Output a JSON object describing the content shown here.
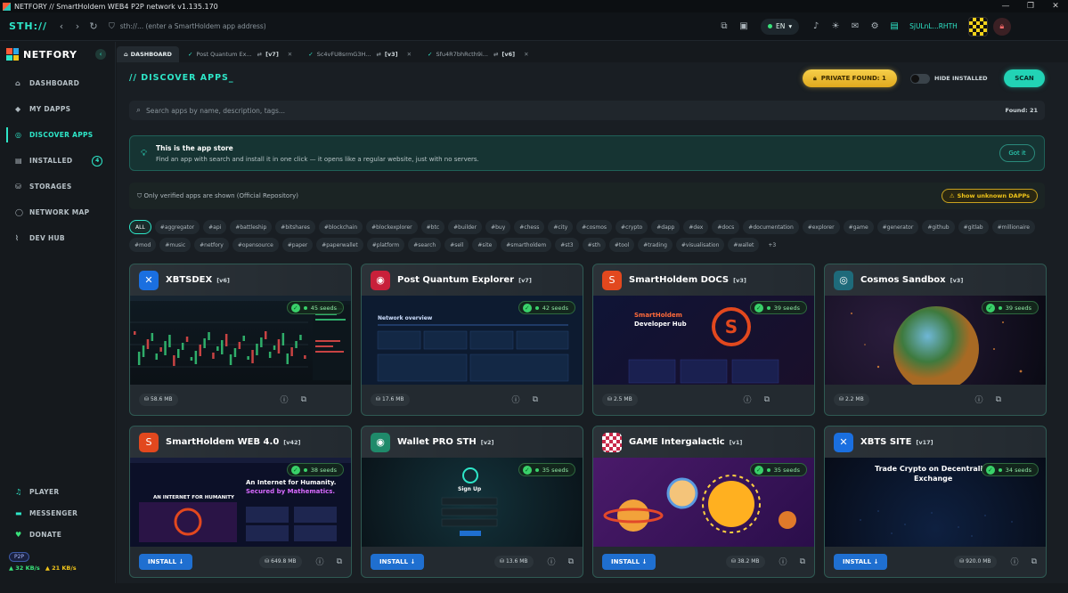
{
  "window": {
    "title": "NETFORY // SmartHoldem WEB4 P2P network v1.135.170",
    "controls": [
      "—",
      "❐",
      "✕"
    ]
  },
  "topbar": {
    "logo": "STH://",
    "address_placeholder": "sth://... (enter a SmartHoldem app address)",
    "language": "EN",
    "wallet": "SjULnL...RHTH"
  },
  "sidebar": {
    "brand": "NETFORY",
    "items": [
      {
        "label": "DASHBOARD",
        "icon": "home-icon"
      },
      {
        "label": "MY DAPPS",
        "icon": "diamond-icon"
      },
      {
        "label": "DISCOVER APPS",
        "icon": "compass-icon",
        "active": true
      },
      {
        "label": "INSTALLED",
        "icon": "installed-icon",
        "badge": "4"
      },
      {
        "label": "STORAGES",
        "icon": "storage-icon"
      },
      {
        "label": "NETWORK MAP",
        "icon": "network-icon"
      },
      {
        "label": "DEV HUB",
        "icon": "code-icon"
      }
    ],
    "bottom": [
      {
        "label": "PLAYER",
        "icon": "music-icon"
      },
      {
        "label": "MESSENGER",
        "icon": "chat-icon"
      },
      {
        "label": "DONATE",
        "icon": "heart-icon"
      }
    ],
    "p2p": "P2P",
    "up_speed": "▲ 32 KB/s",
    "down_speed": "▲ 21 KB/s"
  },
  "tabs": [
    {
      "label": "DASHBOARD",
      "active": true
    },
    {
      "label": "Post Quantum Ex...",
      "ver": "[v7]"
    },
    {
      "label": "Sc4vFU8srmG3H...",
      "ver": "[v3]"
    },
    {
      "label": "Sfu4R7bhRcth9i...",
      "ver": "[v6]"
    }
  ],
  "page": {
    "title": "// DISCOVER APPS_",
    "private_found": "PRIVATE FOUND: 1",
    "hide_installed": "HIDE INSTALLED",
    "scan": "SCAN",
    "search_placeholder": "Search apps by name, description, tags...",
    "found": "Found: 21",
    "info_title": "This is the app store",
    "info_text": "Find an app with search and install it in one click — it opens like a regular website, just with no servers.",
    "got_it": "Got it",
    "verified_text": "Only verified apps are shown (Official Repository)",
    "show_unknown": "Show unknown DAPPs",
    "tags": [
      "ALL",
      "#aggregator",
      "#api",
      "#battleship",
      "#bitshares",
      "#blockchain",
      "#blockexplorer",
      "#btc",
      "#builder",
      "#buy",
      "#chess",
      "#city",
      "#cosmos",
      "#crypto",
      "#dapp",
      "#dex",
      "#docs",
      "#documentation",
      "#explorer",
      "#game",
      "#generator",
      "#github",
      "#gitlab",
      "#millionaire",
      "#mod",
      "#music",
      "#netfory",
      "#opensource",
      "#paper",
      "#paperwallet",
      "#platform",
      "#search",
      "#sell",
      "#site",
      "#smartholdem",
      "#st3",
      "#sth",
      "#tool",
      "#trading",
      "#visualisation",
      "#wallet",
      "+3"
    ]
  },
  "apps": [
    {
      "name": "XBTSDEX",
      "ver": "[v6]",
      "seeds": "45 seeds",
      "size": "58.6 MB",
      "logo_color": "#1a6fe0",
      "installed": true
    },
    {
      "name": "Post Quantum Explorer",
      "ver": "[v7]",
      "seeds": "42 seeds",
      "size": "17.6 MB",
      "logo_color": "#c8203a",
      "installed": true
    },
    {
      "name": "SmartHoldem DOCS",
      "ver": "[v3]",
      "seeds": "39 seeds",
      "size": "2.5 MB",
      "logo_color": "#e2481e",
      "installed": true
    },
    {
      "name": "Cosmos Sandbox",
      "ver": "[v3]",
      "seeds": "39 seeds",
      "size": "2.2 MB",
      "logo_color": "#1e6a7a",
      "installed": true
    },
    {
      "name": "SmartHoldem WEB 4.0",
      "ver": "[v42]",
      "seeds": "38 seeds",
      "size": "649.8 MB",
      "logo_color": "#e2481e",
      "install_label": "INSTALL ↓"
    },
    {
      "name": "Wallet PRO STH",
      "ver": "[v2]",
      "seeds": "35 seeds",
      "size": "13.6 MB",
      "logo_color": "#1f8a6a",
      "install_label": "INSTALL ↓"
    },
    {
      "name": "GAME Intergalactic",
      "ver": "[v1]",
      "seeds": "35 seeds",
      "size": "38.2 MB",
      "logo_color": "#c82a4a",
      "install_label": "INSTALL ↓"
    },
    {
      "name": "XBTS SITE",
      "ver": "[v17]",
      "seeds": "34 seeds",
      "size": "920.0 MB",
      "logo_color": "#1a6fe0",
      "install_label": "INSTALL ↓"
    }
  ],
  "screenshots": {
    "pqe": "Network overview",
    "docs_title": "SmartHoldem",
    "docs_sub": "Developer Hub",
    "web4_left": "AN INTERNET FOR HUMANITY",
    "web4_h1": "An Internet for Humanity.",
    "web4_h2": "Secured by Mathematics.",
    "wallet_signup": "Sign Up",
    "xbts_line1": "Trade Crypto on Decentrali",
    "xbts_line2": "Exchange"
  }
}
